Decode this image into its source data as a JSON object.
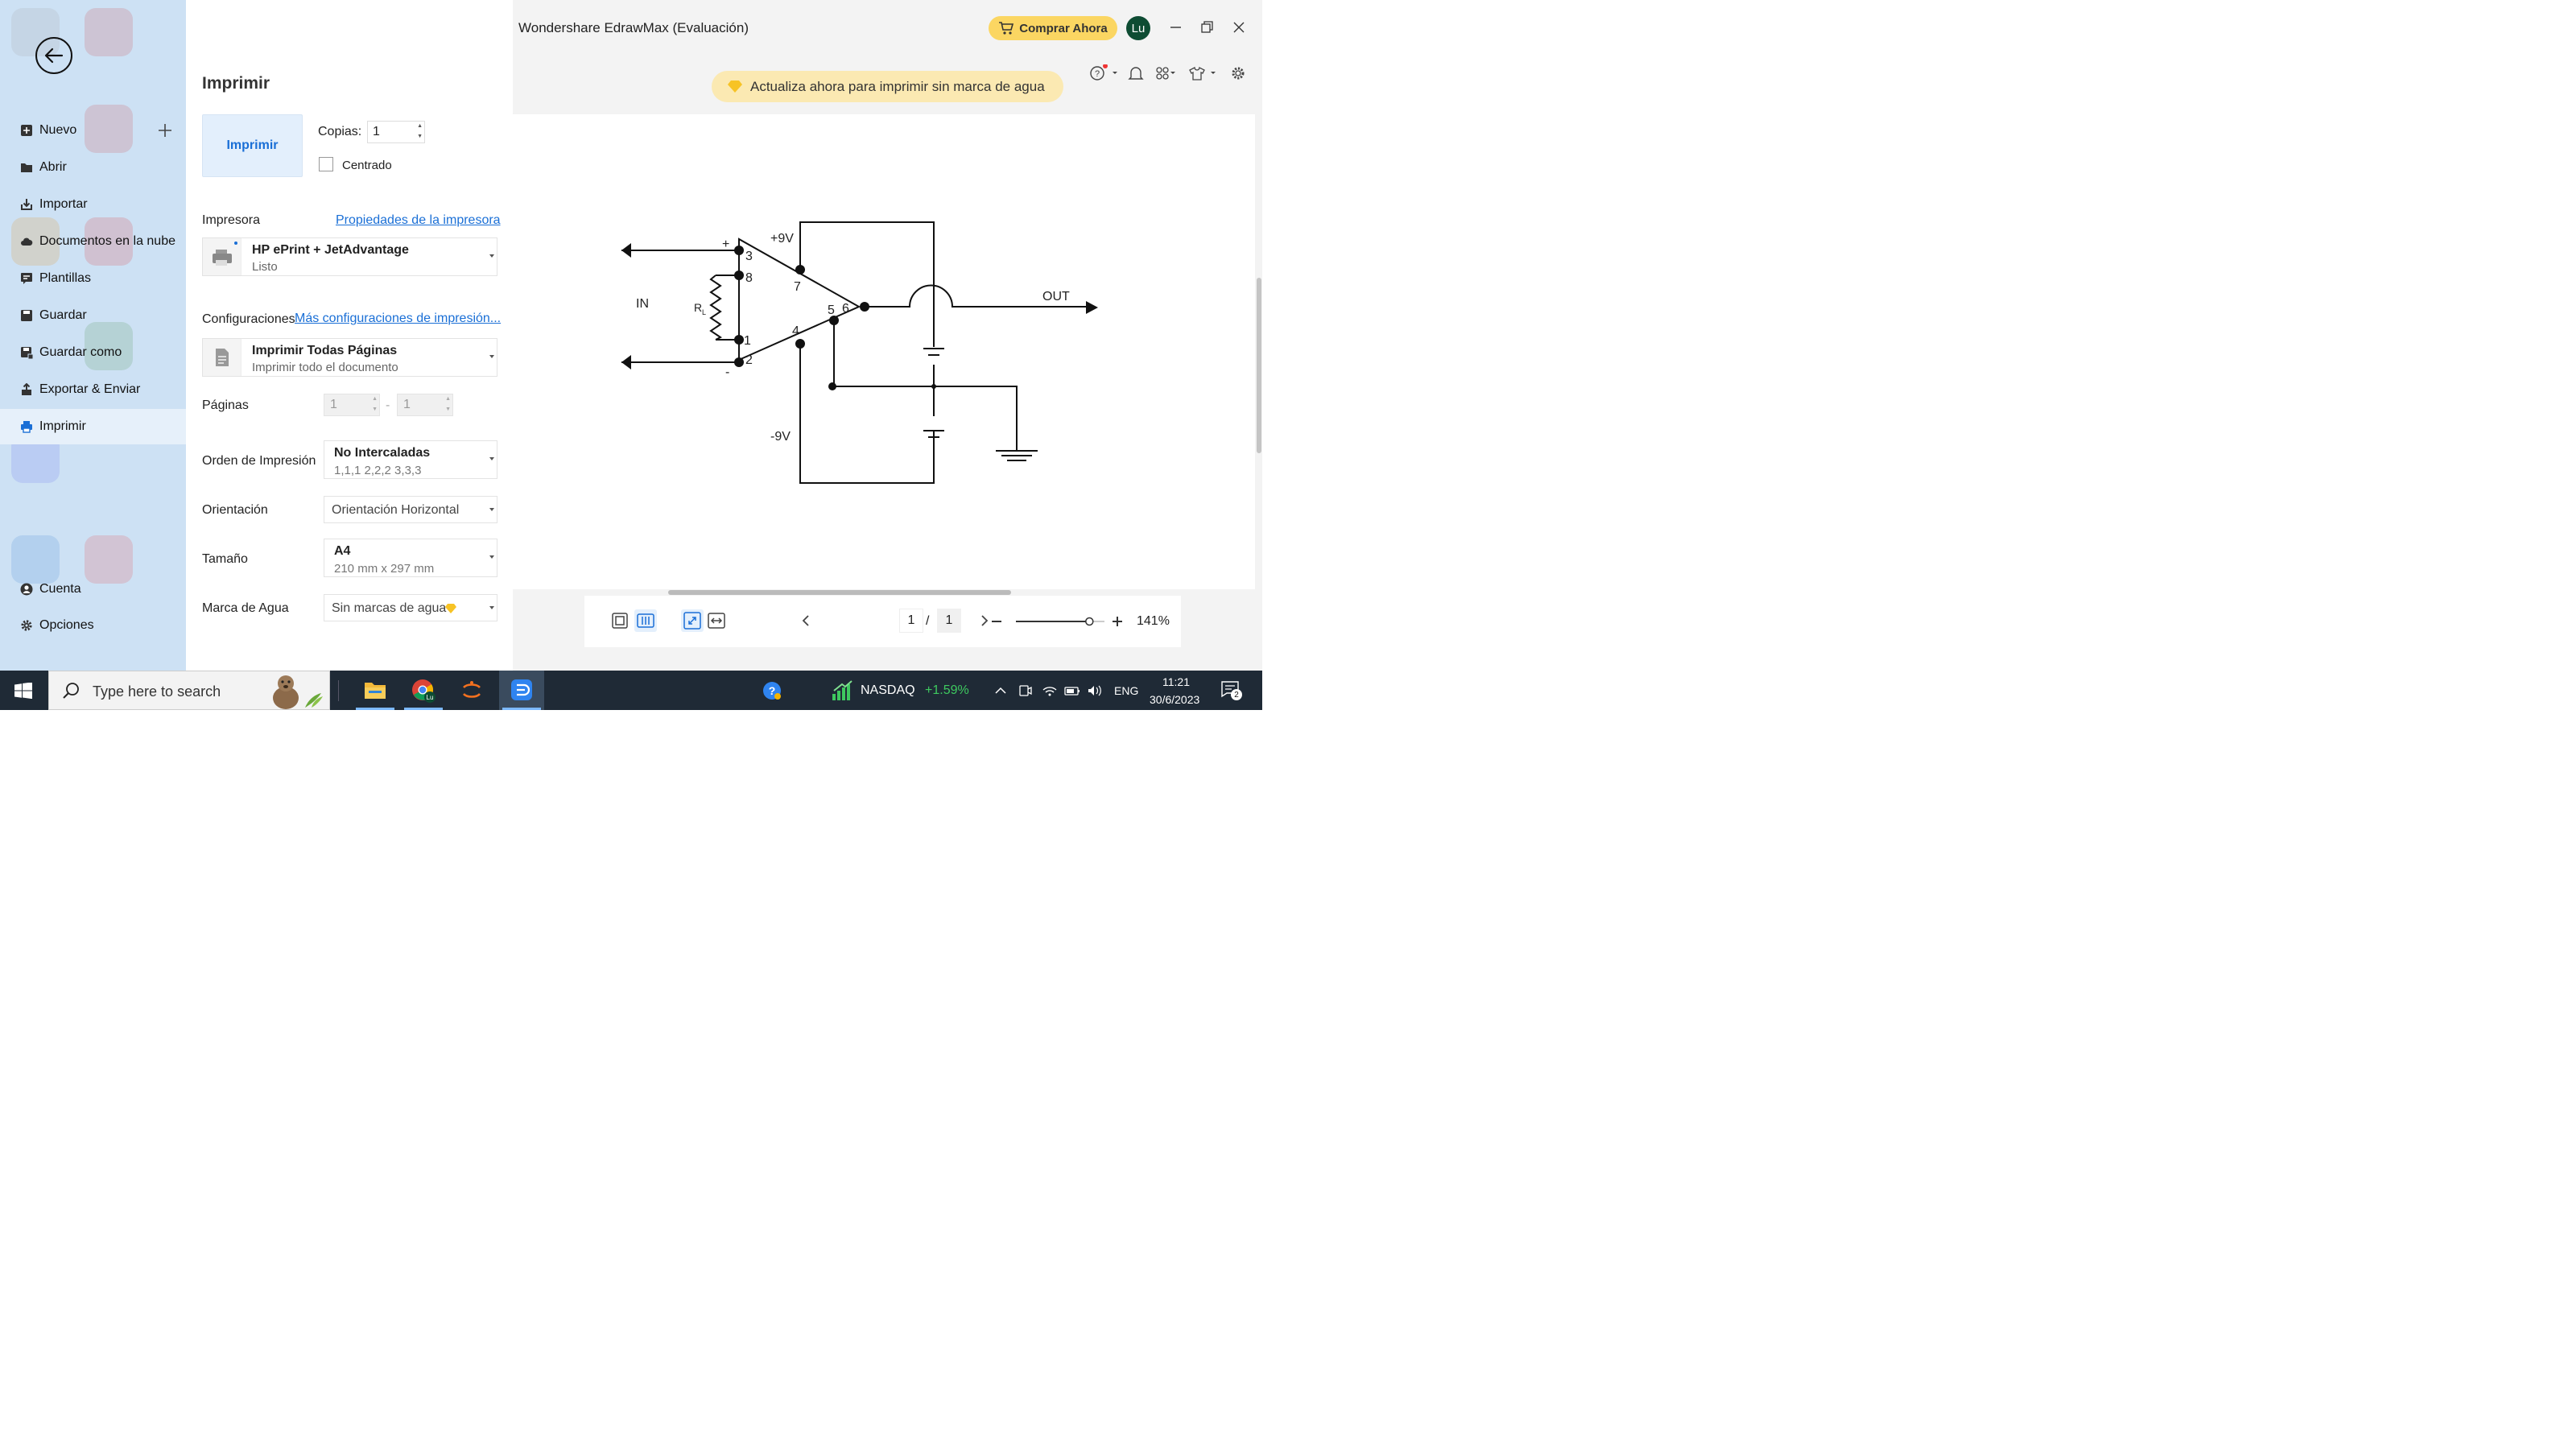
{
  "sidebar": {
    "items": [
      {
        "label": "Nuevo",
        "icon": "new-file-icon"
      },
      {
        "label": "Abrir",
        "icon": "folder-icon"
      },
      {
        "label": "Importar",
        "icon": "import-icon"
      },
      {
        "label": "Documentos en la nube",
        "icon": "cloud-icon"
      },
      {
        "label": "Plantillas",
        "icon": "templates-icon"
      },
      {
        "label": "Guardar",
        "icon": "save-icon"
      },
      {
        "label": "Guardar como",
        "icon": "save-as-icon"
      },
      {
        "label": "Exportar & Enviar",
        "icon": "export-icon"
      },
      {
        "label": "Imprimir",
        "icon": "print-icon",
        "active": true
      }
    ],
    "bottom": [
      {
        "label": "Cuenta",
        "icon": "account-icon"
      },
      {
        "label": "Opciones",
        "icon": "gear-icon"
      }
    ]
  },
  "print": {
    "title": "Imprimir",
    "button": "Imprimir",
    "copies_label": "Copias:",
    "copies_value": "1",
    "centered_label": "Centrado",
    "centered_checked": false,
    "printer_label": "Impresora",
    "printer_props_link": "Propiedades de la impresora",
    "printer_name": "HP ePrint + JetAdvantage",
    "printer_status": "Listo",
    "config_label": "Configuraciones",
    "config_link": "Más configuraciones de impresión...",
    "config_name": "Imprimir Todas Páginas",
    "config_desc": "Imprimir todo el documento",
    "pages_label": "Páginas",
    "pages_from": "1",
    "pages_sep": "-",
    "pages_to": "1",
    "order_label": "Orden de Impresión",
    "order_name": "No Intercaladas",
    "order_desc": "1,1,1   2,2,2   3,3,3",
    "orientation_label": "Orientación",
    "orientation_value": "Orientación Horizontal",
    "size_label": "Tamaño",
    "size_name": "A4",
    "size_desc": "210 mm x 297 mm",
    "watermark_label": "Marca de Agua",
    "watermark_value": "Sin marcas de agua"
  },
  "app": {
    "title": "Wondershare EdrawMax (Evaluación)",
    "buy_label": "Comprar Ahora",
    "avatar": "Lu",
    "banner": "Actualiza ahora para imprimir sin marca de agua"
  },
  "diagram": {
    "in": "IN",
    "out": "OUT",
    "plus9": "+9V",
    "minus9": "-9V",
    "plus": "+",
    "minus": "-",
    "rl": "R",
    "rl_sub": "L",
    "pins": [
      "3",
      "8",
      "1",
      "2",
      "7",
      "5",
      "6",
      "4"
    ]
  },
  "preview_toolbar": {
    "page_current": "1",
    "page_sep": "/",
    "page_total": "1",
    "zoom": "141%",
    "zoom_level": 0.83
  },
  "taskbar": {
    "search_placeholder": "Type here to search",
    "stock_name": "NASDAQ",
    "stock_change": "+1.59%",
    "lang": "ENG",
    "time": "11:21",
    "date": "30/6/2023",
    "notif_count": "2",
    "chrome_badge": "Lu"
  },
  "colors": {
    "accent": "#1a6fd6",
    "sidebar_bg": "#cde1f4",
    "buy_bg": "#fbd662",
    "banner_bg": "#fbe9b2",
    "stock_up": "#3ec95f"
  }
}
